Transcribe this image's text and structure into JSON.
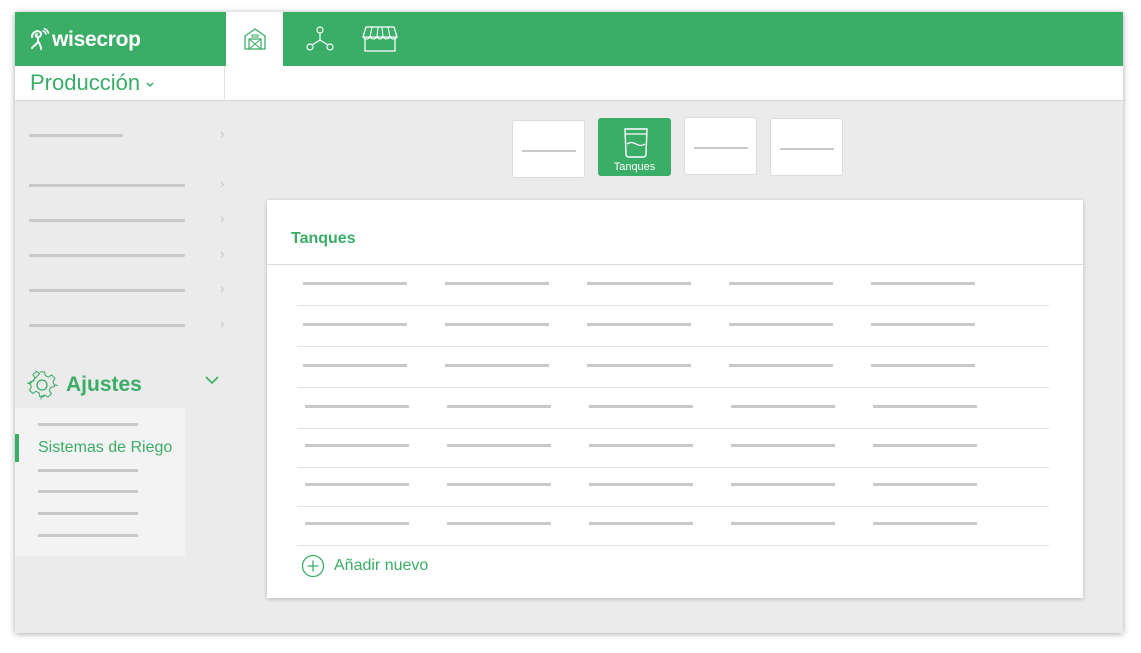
{
  "app": {
    "brand": "wisecrop",
    "brand_color": "#3aad66",
    "section_selector": {
      "label": "Producción",
      "chevron": "chevron-down-icon"
    }
  },
  "top_nav": [
    {
      "icon": "farm-house-icon",
      "active": true
    },
    {
      "icon": "network-nodes-icon",
      "active": false
    },
    {
      "icon": "market-stall-icon",
      "active": false
    }
  ],
  "sidebar": {
    "settings_label": "Ajustes",
    "settings_icon": "gear-icon",
    "settings_toggle_icon": "chevron-down-icon",
    "active_item_label": "Sistemas de Riego"
  },
  "category_tiles": [
    {
      "label": "",
      "active": false
    },
    {
      "label": "Tanques",
      "icon": "tank-icon",
      "active": true
    },
    {
      "label": "",
      "active": false
    },
    {
      "label": "",
      "active": false
    }
  ],
  "main_card": {
    "title": "Tanques",
    "add_new_label": "Añadir nuevo",
    "add_new_icon": "plus-circle-icon"
  }
}
